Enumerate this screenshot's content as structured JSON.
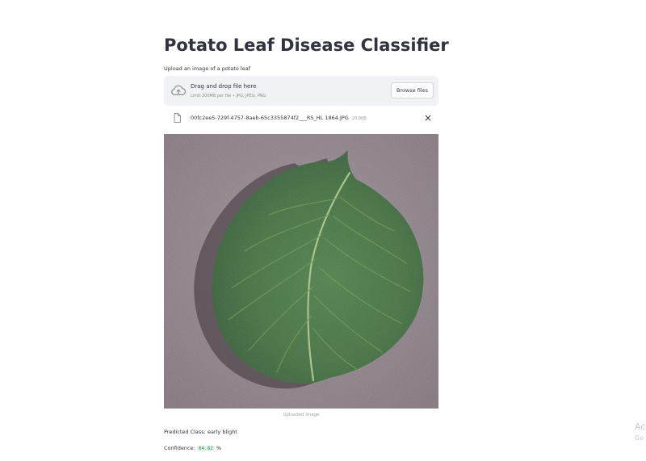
{
  "app": {
    "title": "Potato Leaf Disease Classifier"
  },
  "uploader": {
    "label": "Upload an image of a potato leaf",
    "dropzone_main": "Drag and drop file here",
    "dropzone_sub": "Limit 200MB per file • JPG, JPEG, PNG",
    "browse_label": "Browse files",
    "cloud_icon": "cloud-upload-icon"
  },
  "uploaded_file": {
    "name": "00fc2ee5-729f-4757-8aeb-65c3355874f2___RS_HL 1864.JPG",
    "size": "20.8KB",
    "file_icon": "file-icon",
    "remove_icon": "close-icon",
    "remove_glyph": "×"
  },
  "image": {
    "caption": "Uploaded Image"
  },
  "result": {
    "predicted_label": "Predicted Class:",
    "predicted_value": "early blight",
    "confidence_label": "Confidence:",
    "confidence_value": "64.82",
    "confidence_unit": "%"
  },
  "watermark": {
    "line1": "Ac",
    "line2": "Go"
  },
  "colors": {
    "text": "#31333f",
    "dropzone_bg": "#f0f2f6",
    "confidence_green": "#09ab3b",
    "leaf_green": "#3f6b3a",
    "background_gray": "#8a7e86"
  }
}
